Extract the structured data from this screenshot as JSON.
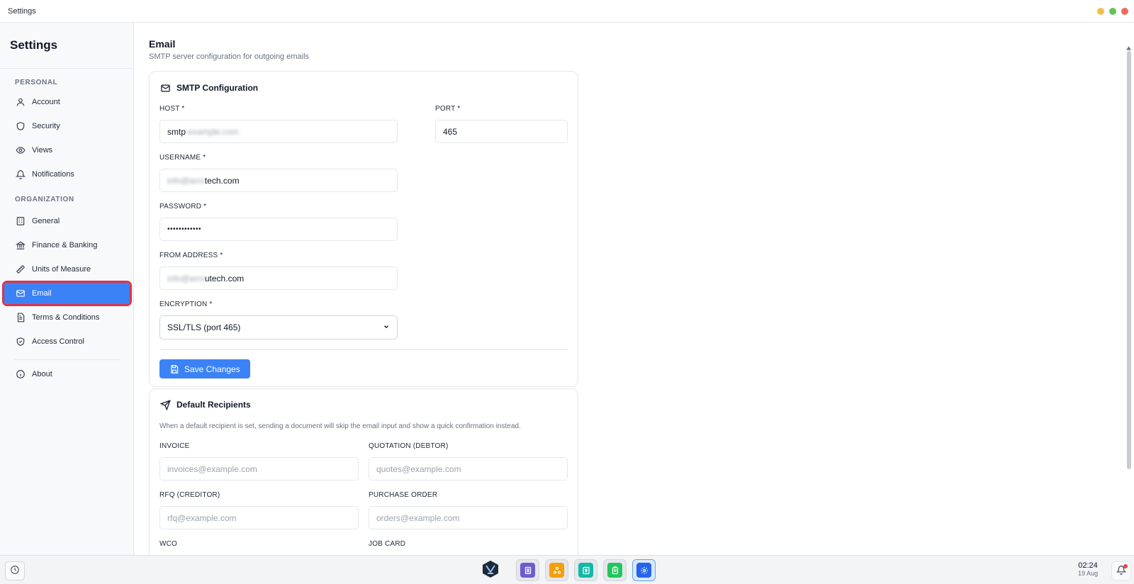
{
  "window": {
    "title": "Settings",
    "controls": {
      "minimize_color": "#f5bf4f",
      "maximize_color": "#61c554",
      "close_color": "#ed6a5e"
    }
  },
  "sidebar": {
    "title": "Settings",
    "sections": {
      "personal": "PERSONAL",
      "organization": "ORGANIZATION"
    },
    "items": {
      "account": "Account",
      "security": "Security",
      "views": "Views",
      "notifications": "Notifications",
      "general": "General",
      "finance": "Finance & Banking",
      "units": "Units of Measure",
      "email": "Email",
      "terms": "Terms & Conditions",
      "access": "Access Control",
      "about": "About"
    },
    "active_item": "Email"
  },
  "main": {
    "title": "Email",
    "subtitle": "SMTP server configuration for outgoing emails",
    "smtp": {
      "title": "SMTP Configuration",
      "host_label": "HOST *",
      "host_value_visible": "smtp",
      "host_value_blurred": ".example.com",
      "port_label": "PORT *",
      "port_value": "465",
      "username_label": "USERNAME *",
      "username_value_blurred": "info@arro",
      "username_value_visible": "tech.com",
      "password_label": "PASSWORD *",
      "password_value": "••••••••••••",
      "from_label": "FROM ADDRESS *",
      "from_value_blurred": "info@arro",
      "from_value_visible": "utech.com",
      "encryption_label": "ENCRYPTION *",
      "encryption_value": "SSL/TLS (port 465)",
      "save_label": "Save Changes"
    },
    "recipients": {
      "title": "Default Recipients",
      "description": "When a default recipient is set, sending a document will skip the email input and show a quick confirmation instead.",
      "invoice_label": "INVOICE",
      "invoice_placeholder": "invoices@example.com",
      "quotation_label": "QUOTATION (DEBTOR)",
      "quotation_placeholder": "quotes@example.com",
      "rfq_label": "RFQ (CREDITOR)",
      "rfq_placeholder": "rfq@example.com",
      "po_label": "PURCHASE ORDER",
      "po_placeholder": "orders@example.com",
      "wco_label": "WCO",
      "jobcard_label": "JOB CARD"
    }
  },
  "taskbar": {
    "time": "02:24",
    "date": "19 Aug",
    "apps": [
      {
        "name": "contacts-app",
        "color": "#6d5bd0"
      },
      {
        "name": "network-app",
        "color": "#f59e0b"
      },
      {
        "name": "finance-app",
        "color": "#14b8a6"
      },
      {
        "name": "notes-app",
        "color": "#22c55e"
      },
      {
        "name": "settings-app",
        "color": "#2563eb"
      }
    ]
  }
}
